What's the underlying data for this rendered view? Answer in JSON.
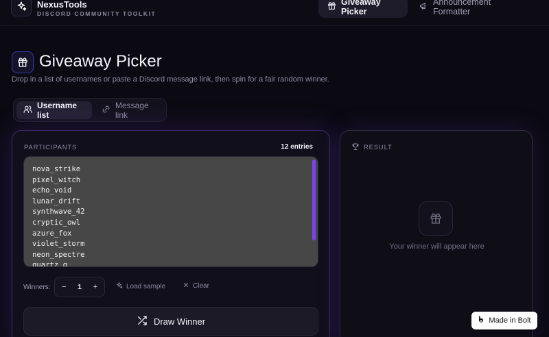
{
  "brand": {
    "name": "NexusTools",
    "subtitle": "DISCORD COMMUNITY TOOLKIT"
  },
  "nav": {
    "tabs": [
      {
        "label": "Giveaway Picker",
        "icon": "gift-icon",
        "active": true
      },
      {
        "label": "Announcement Formatter",
        "icon": "megaphone-icon",
        "active": false
      }
    ]
  },
  "header": {
    "title": "Giveaway Picker",
    "subtitle": "Drop in a list of usernames or paste a Discord message link, then spin for a fair random winner."
  },
  "mode_tabs": [
    {
      "label": "Username list",
      "icon": "users-icon",
      "active": true
    },
    {
      "label": "Message link",
      "icon": "link-icon",
      "active": false
    }
  ],
  "participants": {
    "label": "PARTICIPANTS",
    "count": "12 entries",
    "entries": [
      "nova_strike",
      "pixel_witch",
      "echo_void",
      "lunar_drift",
      "synthwave_42",
      "cryptic_owl",
      "azure_fox",
      "violet_storm",
      "neon_spectre",
      "quartz_q"
    ]
  },
  "controls": {
    "winners_label": "Winners:",
    "minus": "−",
    "winners_value": "1",
    "plus": "+",
    "load_sample": "Load sample",
    "clear": "Clear"
  },
  "draw_button": "Draw Winner",
  "result": {
    "label": "RESULT",
    "empty": "Your winner will appear here"
  },
  "badge": {
    "label": "Made in Bolt"
  },
  "colors": {
    "accent": "#7a44e6",
    "background": "#0b0a12",
    "panel_border": "#3a2a63"
  }
}
